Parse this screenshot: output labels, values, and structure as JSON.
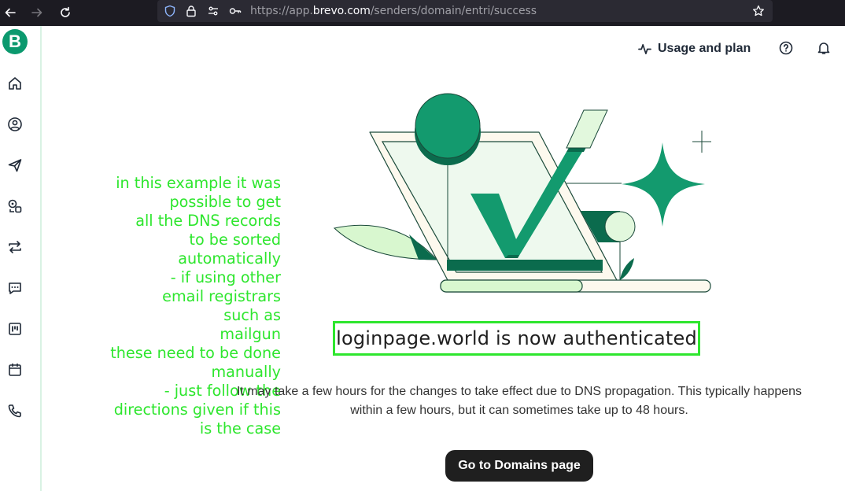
{
  "browser": {
    "url_prefix": "https://app.",
    "url_host": "brevo.com",
    "url_path": "/senders/domain/entri/success"
  },
  "sidebar": {
    "logo_letter": "B",
    "items": [
      {
        "icon": "home-icon"
      },
      {
        "icon": "contacts-icon"
      },
      {
        "icon": "send-icon"
      },
      {
        "icon": "automation-icon"
      },
      {
        "icon": "transactional-icon"
      },
      {
        "icon": "conversations-icon"
      },
      {
        "icon": "deals-icon"
      },
      {
        "icon": "meetings-icon"
      },
      {
        "icon": "phone-icon"
      }
    ]
  },
  "header": {
    "usage_label": "Usage and plan"
  },
  "annotation": {
    "lines": [
      "in this example it was",
      "possible to get",
      "all the DNS records",
      "to be sorted",
      "automatically",
      "- if using other",
      "email registrars",
      "such as",
      "mailgun",
      "these need to be done",
      "manually",
      "- just follow the",
      "directions given if this",
      "is the case"
    ]
  },
  "main": {
    "title": "loginpage.world is now authenticated",
    "description": "It may take a few hours for the changes to take effect due to DNS propagation. This typically happens within a few hours, but it can sometimes take up to 48 hours.",
    "button_label": "Go to Domains page"
  },
  "colors": {
    "brand": "#0b996e",
    "annotation": "#2ee62e",
    "button_bg": "#1f1f1f"
  }
}
